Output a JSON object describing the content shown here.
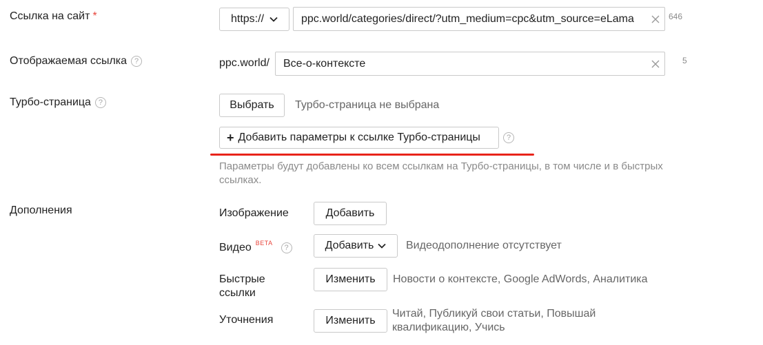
{
  "site_link": {
    "label": "Ссылка на сайт",
    "required_mark": "*",
    "protocol": "https://",
    "url_value": "ppc.world/categories/direct/?utm_medium=cpc&utm_source=eLama",
    "counter": "646"
  },
  "display_link": {
    "label": "Отображаемая ссылка",
    "prefix": "ppc.world/",
    "value": "Все-о-контексте",
    "counter": "5"
  },
  "turbo": {
    "label": "Турбо-страница",
    "choose_button": "Выбрать",
    "status": "Турбо-страница не выбрана",
    "add_params_button": "Добавить параметры к ссылке Турбо-страницы",
    "add_params_plus": "+",
    "hint": "Параметры будут добавлены ко всем ссылкам на Турбо-страницы, в том числе и в быстрых ссылках.",
    "highlight_color": "#e8231a"
  },
  "extras": {
    "label": "Дополнения",
    "image": {
      "label": "Изображение",
      "button": "Добавить"
    },
    "video": {
      "label": "Видео",
      "badge": "BETA",
      "button": "Добавить",
      "status": "Видеодополнение отсутствует"
    },
    "quick_links": {
      "label": "Быстрые ссылки",
      "button": "Изменить",
      "value": "Новости о контексте, Google AdWords, Аналитика"
    },
    "clarifications": {
      "label": "Уточнения",
      "button": "Изменить",
      "value": "Читай, Публикуй свои статьи, Повышай квалификацию, Учись"
    }
  },
  "help_icon_glyph": "?"
}
